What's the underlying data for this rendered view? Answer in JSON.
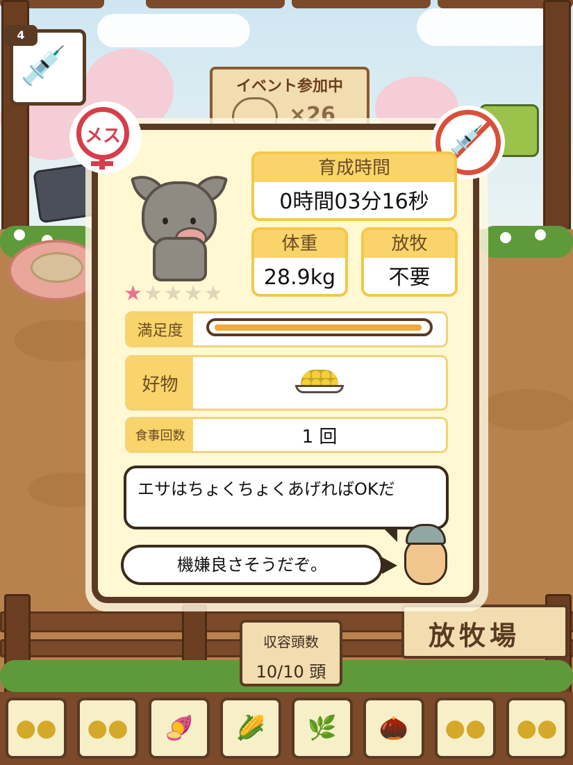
{
  "event_sign": {
    "label": "イベント参加中",
    "count": "×26"
  },
  "syringe": {
    "count": "4",
    "icon": "syringe-icon"
  },
  "badges": {
    "gender_label": "メス",
    "no_injection_icon": "no-syringe-icon"
  },
  "pig": {
    "rating": 1,
    "rating_max": 5
  },
  "stats": {
    "growth_time": {
      "label": "育成時間",
      "value": "0時間03分16秒"
    },
    "weight": {
      "label": "体重",
      "value": "28.9kg"
    },
    "grazing": {
      "label": "放牧",
      "value": "不要"
    }
  },
  "satisfaction": {
    "label": "満足度",
    "level": 0.96
  },
  "favorite": {
    "label": "好物",
    "icon": "grain-bowl-icon"
  },
  "meals": {
    "label": "食事回数",
    "value": "1 回"
  },
  "speech": {
    "line1": "エサはちょくちょくあげればOKだ",
    "line2": "機嫌良さそうだぞ。"
  },
  "capacity": {
    "label": "収容頭数",
    "value": "10/10 頭"
  },
  "ranch_sign": "放牧場",
  "feed_slots": [
    {
      "name": "feed-slot-1",
      "icon": "●●"
    },
    {
      "name": "feed-slot-2",
      "icon": "●●"
    },
    {
      "name": "feed-slot-3",
      "icon": "🍠"
    },
    {
      "name": "feed-slot-4",
      "icon": "🌽"
    },
    {
      "name": "feed-slot-5",
      "icon": "🌿"
    },
    {
      "name": "feed-slot-6",
      "icon": "🌰"
    },
    {
      "name": "feed-slot-7",
      "icon": "●●"
    },
    {
      "name": "feed-slot-8",
      "icon": "●●"
    }
  ],
  "colors": {
    "accent": "#f8d46a",
    "frame": "#5a3a22",
    "female": "#d63e4a",
    "meter": "#f1a93b"
  }
}
